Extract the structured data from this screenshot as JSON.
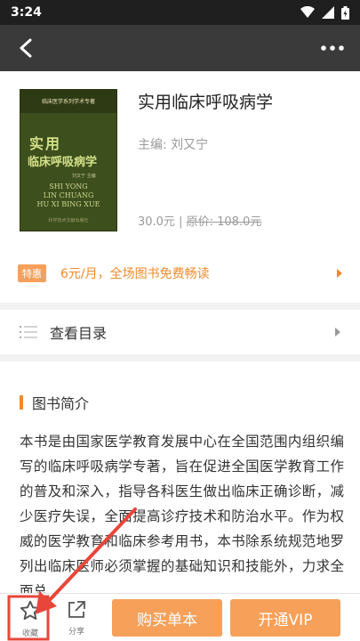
{
  "status_bar": {
    "time": "3:24"
  },
  "book": {
    "title": "实用临床呼吸病学",
    "editor": "主编: 刘又宁",
    "price": "30.0元",
    "separator": " | ",
    "orig_label": "原价: ",
    "orig_price": "108.0元",
    "cover": {
      "series": "临床医学系列学术专著",
      "title_line1": "实用",
      "title_line2": "临床呼吸病学",
      "author": "刘又宁 主编",
      "pinyin1": "SHI YONG",
      "pinyin2": "LIN CHUANG",
      "pinyin3": "HU XI BING XUE",
      "publisher": "科学技术文献出版社"
    }
  },
  "promo": {
    "badge": "特惠",
    "text": "6元/月，全场图书免费畅读"
  },
  "toc": {
    "label": "查看目录"
  },
  "intro": {
    "title": "图书简介",
    "text": "本书是由国家医学教育发展中心在全国范围内组织编写的临床呼吸病学专著，旨在促进全国医学教育工作的普及和深入，指导各科医生做出临床正确诊断，减少医疗失误，全面提高诊疗技术和防治水平。作为权威的医学教育和临床参考用书，本书除系统规范地罗列出临床医师必须掌握的基础知识和技能外，力求全面总"
  },
  "bottom": {
    "favorite_label": "收藏",
    "share_label": "分享",
    "buy_label": "购买单本",
    "vip_label": "开通VIP"
  },
  "colors": {
    "accent": "#f6a05a",
    "header": "#3a3a3a",
    "annotation": "#e8463a"
  }
}
